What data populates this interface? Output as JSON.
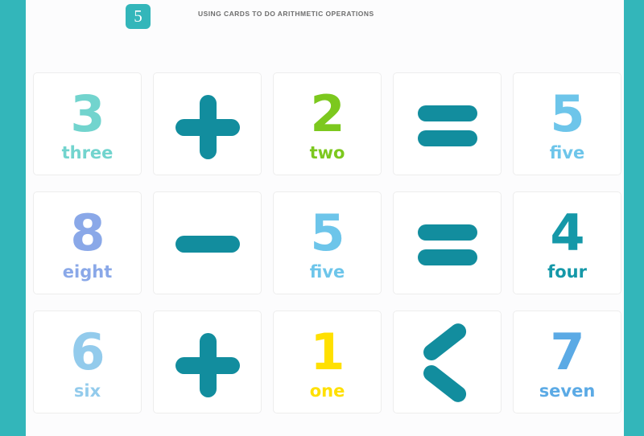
{
  "theme": {
    "rail_color": "#33B6BA",
    "badge_color": "#33B6BA",
    "page_background": "#FCFCFD",
    "card_background": "#FFFFFF",
    "card_border": "#EDEDED",
    "operator_color": "#128D9E",
    "title_color": "#6E6E6E"
  },
  "header": {
    "badge_number": "5",
    "title": "USING CARDS TO DO ARITHMETIC OPERATIONS"
  },
  "grid": {
    "rows": 3,
    "columns": 5,
    "cards": [
      {
        "kind": "number",
        "digit": "3",
        "word": "three",
        "color": "#72D4CE",
        "name": "card-three"
      },
      {
        "kind": "operator",
        "symbol": "plus",
        "glyph": "+",
        "color": "#128D9E",
        "name": "card-plus-1"
      },
      {
        "kind": "number",
        "digit": "2",
        "word": "two",
        "color": "#7CC81E",
        "name": "card-two"
      },
      {
        "kind": "operator",
        "symbol": "equals",
        "glyph": "=",
        "color": "#128D9E",
        "name": "card-equals-1"
      },
      {
        "kind": "number",
        "digit": "5",
        "word": "five",
        "color": "#6DC5EA",
        "name": "card-five-1"
      },
      {
        "kind": "number",
        "digit": "8",
        "word": "eight",
        "color": "#8AA8E8",
        "name": "card-eight"
      },
      {
        "kind": "operator",
        "symbol": "minus",
        "glyph": "−",
        "color": "#128D9E",
        "name": "card-minus"
      },
      {
        "kind": "number",
        "digit": "5",
        "word": "five",
        "color": "#6DC5EA",
        "name": "card-five-2"
      },
      {
        "kind": "operator",
        "symbol": "equals",
        "glyph": "=",
        "color": "#128D9E",
        "name": "card-equals-2"
      },
      {
        "kind": "number",
        "digit": "4",
        "word": "four",
        "color": "#1598A8",
        "name": "card-four"
      },
      {
        "kind": "number",
        "digit": "6",
        "word": "six",
        "color": "#93CBEC",
        "name": "card-six"
      },
      {
        "kind": "operator",
        "symbol": "plus",
        "glyph": "+",
        "color": "#128D9E",
        "name": "card-plus-2"
      },
      {
        "kind": "number",
        "digit": "1",
        "word": "one",
        "color": "#FFE000",
        "name": "card-one"
      },
      {
        "kind": "operator",
        "symbol": "less-than",
        "glyph": "<",
        "color": "#128D9E",
        "name": "card-less-than"
      },
      {
        "kind": "number",
        "digit": "7",
        "word": "seven",
        "color": "#5BAAE5",
        "name": "card-seven"
      }
    ],
    "equations": [
      "3 + 2 = 5",
      "8 − 5 = 4",
      "6 + 1 < 7"
    ]
  }
}
